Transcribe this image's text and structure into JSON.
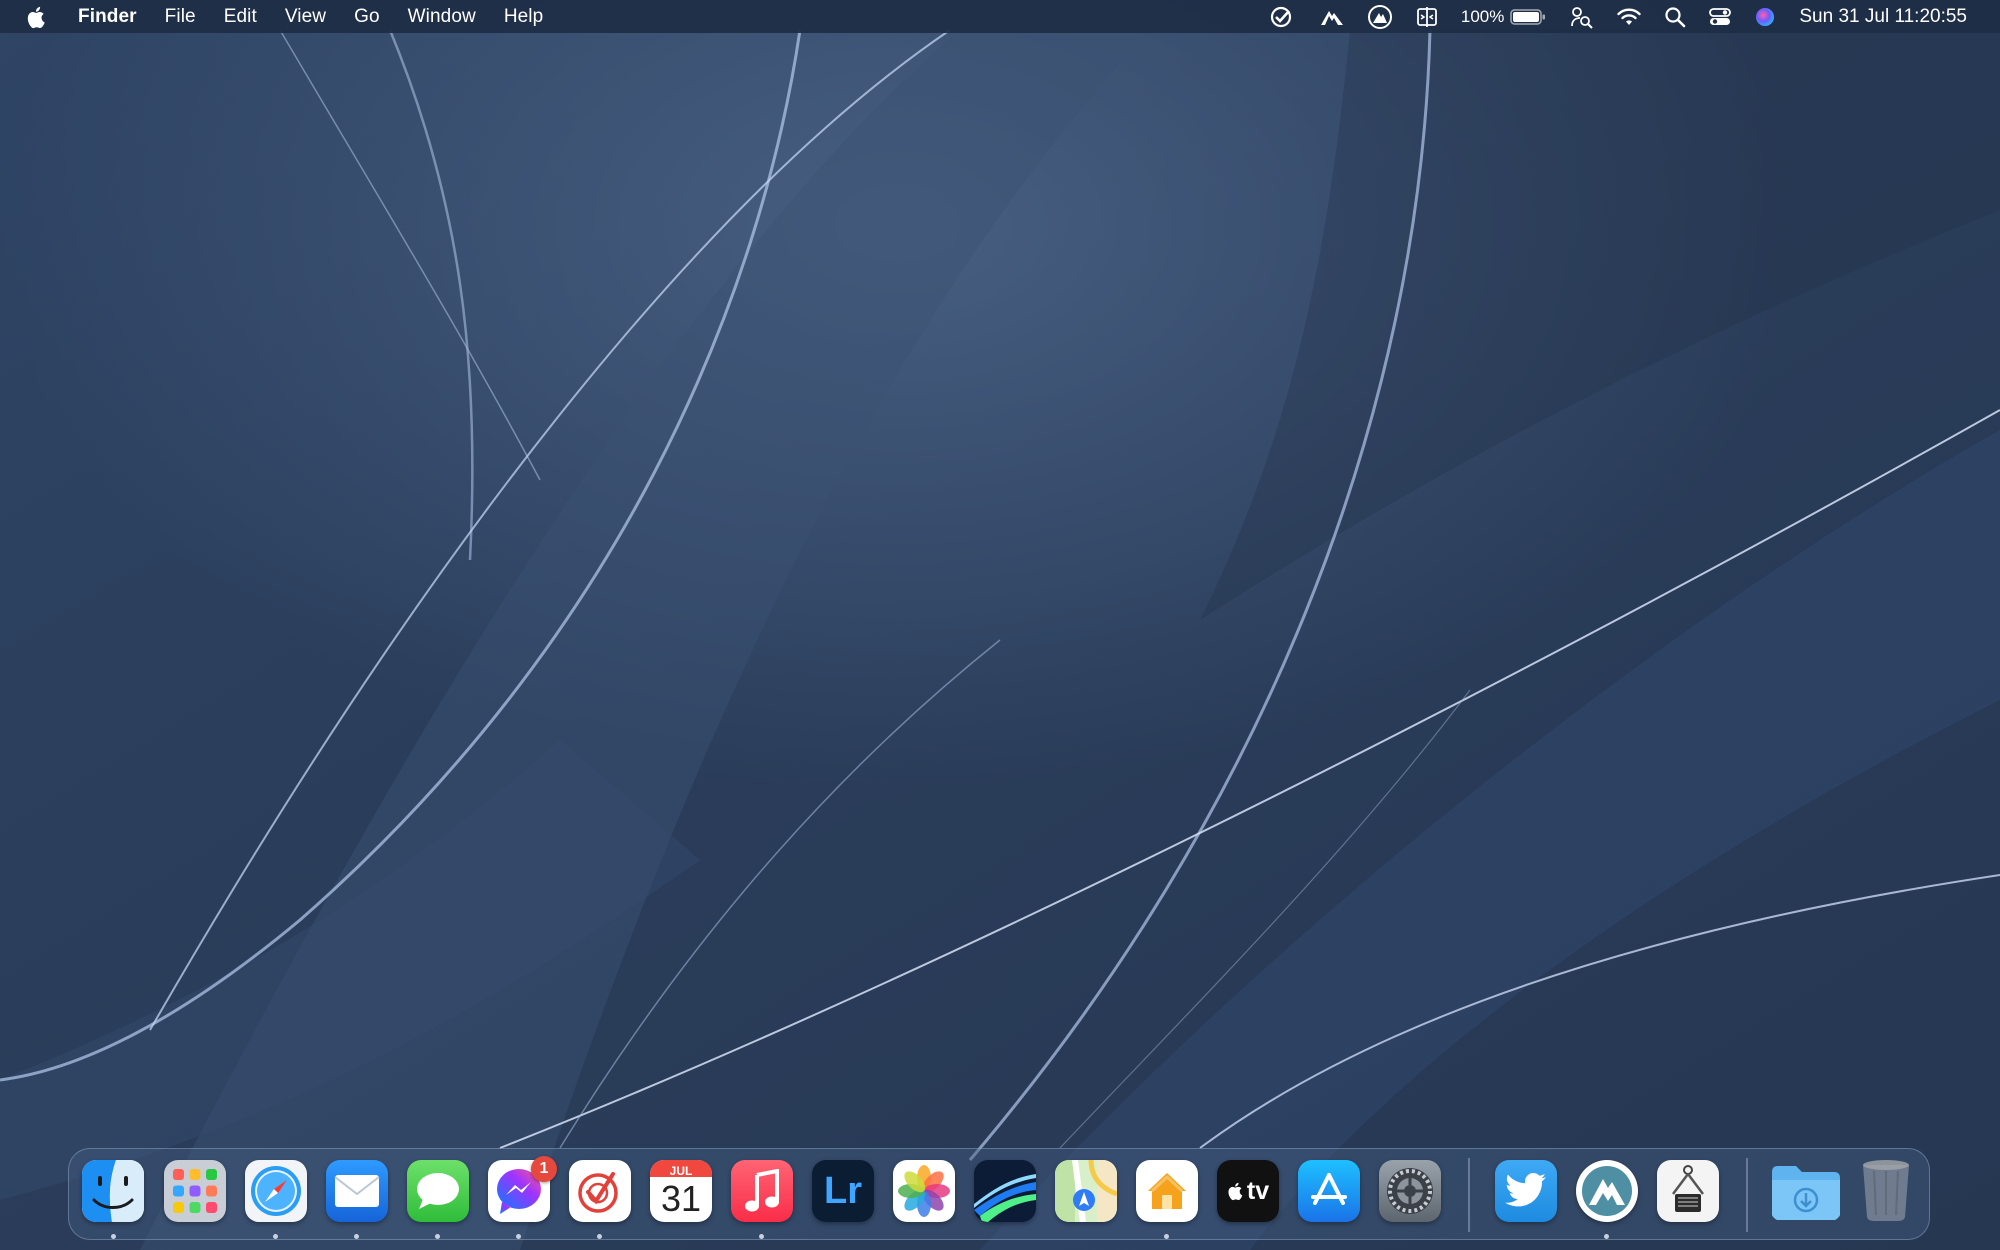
{
  "menubar": {
    "app_name": "Finder",
    "menus": [
      "File",
      "Edit",
      "View",
      "Go",
      "Window",
      "Help"
    ],
    "status_icons": [
      "taskheat-icon",
      "nordvpn-icon",
      "hand-icon",
      "split-view-icon",
      "battery-icon",
      "search-icon",
      "wifi-icon",
      "spotlight-icon",
      "control-center-icon",
      "siri-icon"
    ],
    "battery_percent": "100%",
    "battery_level": 1.0,
    "clock": "Sun 31 Jul  11:20:55"
  },
  "dock": {
    "apps": [
      {
        "name": "Finder",
        "icon": "finder-icon",
        "running": true
      },
      {
        "name": "Launchpad",
        "icon": "launchpad-icon",
        "running": false
      },
      {
        "name": "Safari",
        "icon": "safari-icon",
        "running": true
      },
      {
        "name": "Mail",
        "icon": "mail-icon",
        "running": true
      },
      {
        "name": "Messages",
        "icon": "messages-icon",
        "running": true
      },
      {
        "name": "Messenger",
        "icon": "messenger-icon",
        "running": true,
        "badge": "1"
      },
      {
        "name": "Tasks",
        "icon": "tasks-icon",
        "running": true
      },
      {
        "name": "Calendar",
        "icon": "calendar-icon",
        "running": false,
        "month": "JUL",
        "day": "31"
      },
      {
        "name": "Music",
        "icon": "music-icon",
        "running": true
      },
      {
        "name": "Lightroom",
        "icon": "lightroom-icon",
        "running": false,
        "text": "Lr"
      },
      {
        "name": "Photos",
        "icon": "photos-icon",
        "running": false
      },
      {
        "name": "Fusion",
        "icon": "fusion-icon",
        "running": false
      },
      {
        "name": "Maps",
        "icon": "maps-icon",
        "running": false
      },
      {
        "name": "Home",
        "icon": "home-icon",
        "running": true
      },
      {
        "name": "TV",
        "icon": "appletv-icon",
        "running": false,
        "text": "tv"
      },
      {
        "name": "App Store",
        "icon": "appstore-icon",
        "running": false
      },
      {
        "name": "System Preferences",
        "icon": "settings-icon",
        "running": false
      },
      {
        "name": "Twitter",
        "icon": "twitter-icon",
        "running": false
      },
      {
        "name": "NordVPN",
        "icon": "nordvpn-app-icon",
        "running": true
      },
      {
        "name": "System Information",
        "icon": "system-info-icon",
        "running": false
      },
      {
        "name": "Downloads",
        "icon": "downloads-folder-icon",
        "running": false
      },
      {
        "name": "Trash",
        "icon": "trash-icon",
        "running": false
      }
    ]
  },
  "colors": {
    "menubar_bg": "#1f2e46",
    "wallpaper_dark": "#22324b",
    "wallpaper_light": "#3f5778",
    "badge": "#e5483d"
  }
}
